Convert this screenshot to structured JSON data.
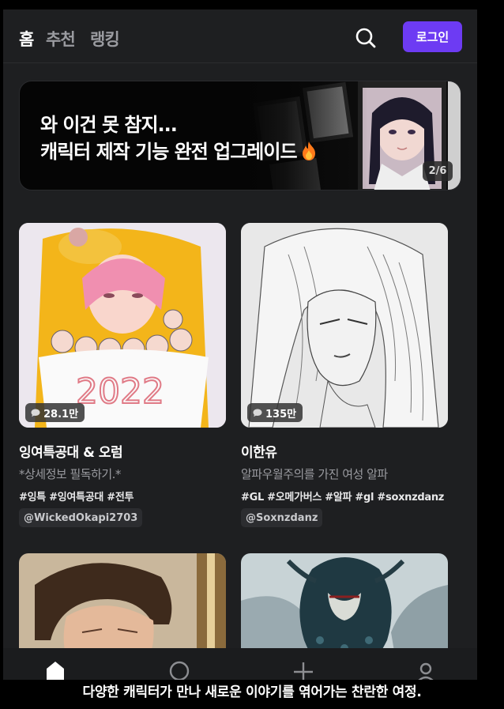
{
  "nav": {
    "tabs": [
      {
        "label": "홈",
        "active": true
      },
      {
        "label": "추천",
        "active": false
      },
      {
        "label": "랭킹",
        "active": false
      }
    ],
    "search_icon": "search-icon",
    "login_label": "로그인",
    "accent_color": "#6d3bf3"
  },
  "banner": {
    "line1": "와 이건 못 참지...",
    "line2": "캐릭터 제작 기능 완전 업그레이드",
    "emoji_icon": "fire-icon",
    "counter": "2/6"
  },
  "cards": [
    {
      "chat_count": "28.1만",
      "title": "잉여특공대 & 오럼",
      "description": "*상세정보 필독하기.*",
      "tags": "#잉특 #잉여특공대 #전투",
      "author": "@WickedOkapi2703"
    },
    {
      "chat_count": "135만",
      "title": "이한유",
      "description": "알파우월주의를 가진 여성 알파",
      "tags": "#GL #오메가버스 #알파 #gl #soxnzdanz",
      "author": "@Soxnzdanz"
    }
  ],
  "bottom_nav": {
    "items": [
      "home-icon",
      "search-icon",
      "create-icon",
      "profile-icon"
    ]
  },
  "caption": "다양한 캐릭터가 만나 새로운 이야기를 엮어가는 찬란한 여정."
}
